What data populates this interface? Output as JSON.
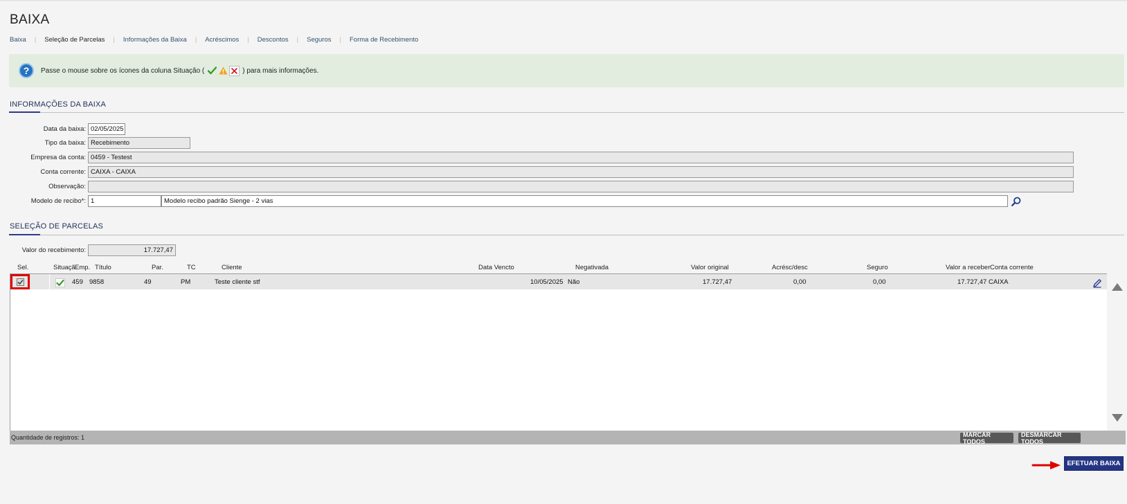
{
  "page": {
    "title": "BAIXA"
  },
  "breadcrumbs": [
    {
      "label": "Baixa",
      "active": false
    },
    {
      "label": "Seleção de Parcelas",
      "active": true
    },
    {
      "label": "Informações da Baixa",
      "active": false
    },
    {
      "label": "Acréscimos",
      "active": false
    },
    {
      "label": "Descontos",
      "active": false
    },
    {
      "label": "Seguros",
      "active": false
    },
    {
      "label": "Forma de Recebimento",
      "active": false
    }
  ],
  "info": {
    "text_before": "Passe o mouse sobre os ícones da coluna Situação (",
    "text_after": ") para mais informações.",
    "icons": [
      "check-icon",
      "warning-icon",
      "x-icon"
    ]
  },
  "sections": {
    "info_baixa": "INFORMAÇÕES DA BAIXA",
    "selecao": "SELEÇÃO DE PARCELAS"
  },
  "form": {
    "data_label": "Data da baixa:",
    "data_value": "02/05/2025",
    "tipo_label": "Tipo da baixa:",
    "tipo_value": "Recebimento",
    "empresa_label": "Empresa da conta:",
    "empresa_value": "0459 - Testest",
    "conta_label": "Conta corrente:",
    "conta_value": "CAIXA - CAIXA",
    "obs_label": "Observação:",
    "obs_value": "",
    "modelo_label": "Modelo de recibo*:",
    "modelo_code": "1",
    "modelo_desc": "Modelo recibo padrão Sienge - 2 vias"
  },
  "valor": {
    "label": "Valor do recebimento:",
    "value": "17.727,47"
  },
  "grid": {
    "headers": {
      "sel": "Sel.",
      "situacao": "Situaçã",
      "emp": "Emp.",
      "titulo": "Título",
      "par": "Par.",
      "tc": "TC",
      "cliente": "Cliente",
      "vencto": "Data Vencto",
      "negativada": "Negativada",
      "valor_original": "Valor original",
      "acresc": "Acrésc/desc",
      "seguro": "Seguro",
      "valor_receber": "Valor a receber",
      "conta": "Conta corrente"
    },
    "rows": [
      {
        "selected": true,
        "situacao": "check-icon",
        "emp": "459",
        "titulo": "9858",
        "par": "49",
        "tc": "PM",
        "cliente": "Teste cliente stf",
        "vencto": "10/05/2025",
        "negativada": "Não",
        "valor_original": "17.727,47",
        "acresc": "0,00",
        "seguro": "0,00",
        "valor_receber": "17.727,47",
        "conta": "CAIXA"
      }
    ],
    "footer_count": "Quantidade de registros: 1",
    "btn_marcar": "MARCAR TODOS",
    "btn_desmarcar": "DESMARCAR TODOS"
  },
  "actions": {
    "efetuar": "EFETUAR BAIXA"
  },
  "colors": {
    "primary": "#243583",
    "accent_red": "#e00000",
    "info_bg": "#e3eddf",
    "check_green": "#3a9a2a"
  }
}
